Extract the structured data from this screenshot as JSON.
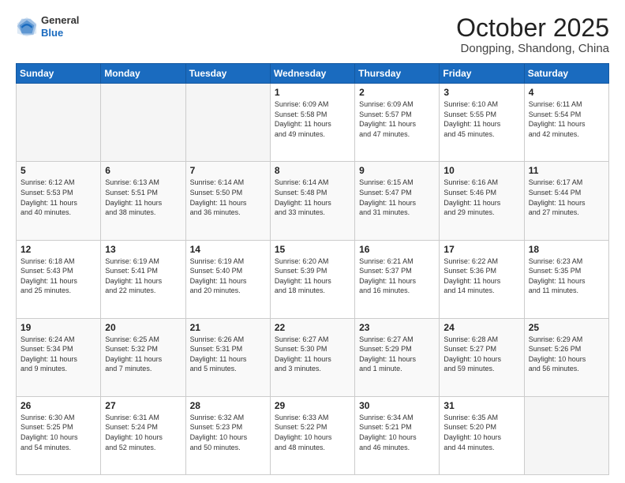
{
  "logo": {
    "general": "General",
    "blue": "Blue"
  },
  "title": "October 2025",
  "subtitle": "Dongping, Shandong, China",
  "weekdays": [
    "Sunday",
    "Monday",
    "Tuesday",
    "Wednesday",
    "Thursday",
    "Friday",
    "Saturday"
  ],
  "weeks": [
    [
      {
        "day": "",
        "info": ""
      },
      {
        "day": "",
        "info": ""
      },
      {
        "day": "",
        "info": ""
      },
      {
        "day": "1",
        "info": "Sunrise: 6:09 AM\nSunset: 5:58 PM\nDaylight: 11 hours\nand 49 minutes."
      },
      {
        "day": "2",
        "info": "Sunrise: 6:09 AM\nSunset: 5:57 PM\nDaylight: 11 hours\nand 47 minutes."
      },
      {
        "day": "3",
        "info": "Sunrise: 6:10 AM\nSunset: 5:55 PM\nDaylight: 11 hours\nand 45 minutes."
      },
      {
        "day": "4",
        "info": "Sunrise: 6:11 AM\nSunset: 5:54 PM\nDaylight: 11 hours\nand 42 minutes."
      }
    ],
    [
      {
        "day": "5",
        "info": "Sunrise: 6:12 AM\nSunset: 5:53 PM\nDaylight: 11 hours\nand 40 minutes."
      },
      {
        "day": "6",
        "info": "Sunrise: 6:13 AM\nSunset: 5:51 PM\nDaylight: 11 hours\nand 38 minutes."
      },
      {
        "day": "7",
        "info": "Sunrise: 6:14 AM\nSunset: 5:50 PM\nDaylight: 11 hours\nand 36 minutes."
      },
      {
        "day": "8",
        "info": "Sunrise: 6:14 AM\nSunset: 5:48 PM\nDaylight: 11 hours\nand 33 minutes."
      },
      {
        "day": "9",
        "info": "Sunrise: 6:15 AM\nSunset: 5:47 PM\nDaylight: 11 hours\nand 31 minutes."
      },
      {
        "day": "10",
        "info": "Sunrise: 6:16 AM\nSunset: 5:46 PM\nDaylight: 11 hours\nand 29 minutes."
      },
      {
        "day": "11",
        "info": "Sunrise: 6:17 AM\nSunset: 5:44 PM\nDaylight: 11 hours\nand 27 minutes."
      }
    ],
    [
      {
        "day": "12",
        "info": "Sunrise: 6:18 AM\nSunset: 5:43 PM\nDaylight: 11 hours\nand 25 minutes."
      },
      {
        "day": "13",
        "info": "Sunrise: 6:19 AM\nSunset: 5:41 PM\nDaylight: 11 hours\nand 22 minutes."
      },
      {
        "day": "14",
        "info": "Sunrise: 6:19 AM\nSunset: 5:40 PM\nDaylight: 11 hours\nand 20 minutes."
      },
      {
        "day": "15",
        "info": "Sunrise: 6:20 AM\nSunset: 5:39 PM\nDaylight: 11 hours\nand 18 minutes."
      },
      {
        "day": "16",
        "info": "Sunrise: 6:21 AM\nSunset: 5:37 PM\nDaylight: 11 hours\nand 16 minutes."
      },
      {
        "day": "17",
        "info": "Sunrise: 6:22 AM\nSunset: 5:36 PM\nDaylight: 11 hours\nand 14 minutes."
      },
      {
        "day": "18",
        "info": "Sunrise: 6:23 AM\nSunset: 5:35 PM\nDaylight: 11 hours\nand 11 minutes."
      }
    ],
    [
      {
        "day": "19",
        "info": "Sunrise: 6:24 AM\nSunset: 5:34 PM\nDaylight: 11 hours\nand 9 minutes."
      },
      {
        "day": "20",
        "info": "Sunrise: 6:25 AM\nSunset: 5:32 PM\nDaylight: 11 hours\nand 7 minutes."
      },
      {
        "day": "21",
        "info": "Sunrise: 6:26 AM\nSunset: 5:31 PM\nDaylight: 11 hours\nand 5 minutes."
      },
      {
        "day": "22",
        "info": "Sunrise: 6:27 AM\nSunset: 5:30 PM\nDaylight: 11 hours\nand 3 minutes."
      },
      {
        "day": "23",
        "info": "Sunrise: 6:27 AM\nSunset: 5:29 PM\nDaylight: 11 hours\nand 1 minute."
      },
      {
        "day": "24",
        "info": "Sunrise: 6:28 AM\nSunset: 5:27 PM\nDaylight: 10 hours\nand 59 minutes."
      },
      {
        "day": "25",
        "info": "Sunrise: 6:29 AM\nSunset: 5:26 PM\nDaylight: 10 hours\nand 56 minutes."
      }
    ],
    [
      {
        "day": "26",
        "info": "Sunrise: 6:30 AM\nSunset: 5:25 PM\nDaylight: 10 hours\nand 54 minutes."
      },
      {
        "day": "27",
        "info": "Sunrise: 6:31 AM\nSunset: 5:24 PM\nDaylight: 10 hours\nand 52 minutes."
      },
      {
        "day": "28",
        "info": "Sunrise: 6:32 AM\nSunset: 5:23 PM\nDaylight: 10 hours\nand 50 minutes."
      },
      {
        "day": "29",
        "info": "Sunrise: 6:33 AM\nSunset: 5:22 PM\nDaylight: 10 hours\nand 48 minutes."
      },
      {
        "day": "30",
        "info": "Sunrise: 6:34 AM\nSunset: 5:21 PM\nDaylight: 10 hours\nand 46 minutes."
      },
      {
        "day": "31",
        "info": "Sunrise: 6:35 AM\nSunset: 5:20 PM\nDaylight: 10 hours\nand 44 minutes."
      },
      {
        "day": "",
        "info": ""
      }
    ]
  ]
}
